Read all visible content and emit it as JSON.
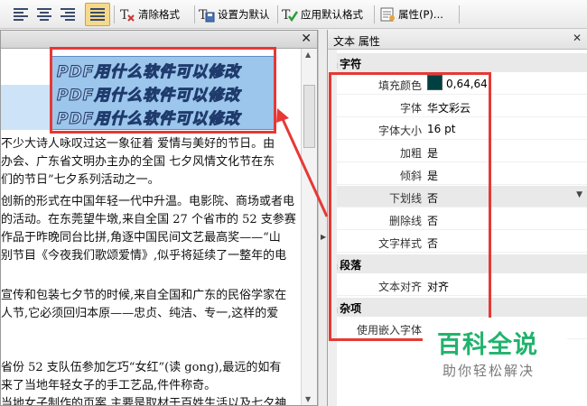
{
  "toolbar": {
    "clear_format": "清除格式",
    "set_default": "设置为默认",
    "apply_default": "应用默认格式",
    "properties": "属性(P)..."
  },
  "document": {
    "selected_lines": [
      "PDF用什么软件可以修改",
      "PDF用什么软件可以修改",
      "PDF用什么软件可以修改"
    ],
    "lines": [
      "不少大诗人咏叹过这一象征着 爱情与美好的节日。由",
      "办会、广东省文明办主办的全国 七夕风情文化节在东",
      "们的节日”七夕系列活动之一。",
      "创新的形式在中国年轻一代中升温。电影院、商场或者电",
      "的活动。在东莞望牛墩,来自全国 27 个省市的 52 支参赛",
      "作品于昨晚同台比拼,角逐中国民间文艺最高奖——“山",
      "别节目《今夜我们歌颂爱情》,似乎将延续了一整年的电",
      "",
      "宣传和包装七夕节的时候,来自全国和广东的民俗学家在",
      "人节,它必须回归本原——忠贞、纯洁、专一,这样的爱",
      "",
      "",
      "省份 52 支队伍参加乞巧“女红”(读 gong),最远的如有",
      "来了当地年轻女子的手工艺品,件件称奇。",
      "当地女子制作的页案,主要是取材于百姓生活以及七夕神"
    ]
  },
  "properties_panel": {
    "title": "文本 属性",
    "categories": {
      "character": "字符",
      "paragraph": "段落",
      "misc": "杂项"
    },
    "rows": {
      "fill_color": {
        "key": "填充颜色",
        "value": "0,64,64",
        "color": "#004040"
      },
      "font": {
        "key": "字体",
        "value": "华文彩云"
      },
      "font_size": {
        "key": "字体大小",
        "value": "16 pt"
      },
      "bold": {
        "key": "加粗",
        "value": "是"
      },
      "italic": {
        "key": "倾斜",
        "value": "是"
      },
      "underline": {
        "key": "下划线",
        "value": "否"
      },
      "strikethrough": {
        "key": "删除线",
        "value": "否"
      },
      "text_style": {
        "key": "文字样式",
        "value": "否"
      },
      "text_align": {
        "key": "文本对齐",
        "value": "对齐"
      },
      "embedded_font": {
        "key": "使用嵌入字体",
        "value": ""
      }
    }
  },
  "watermark": {
    "brand": "百科全说",
    "slogan": "助你轻松解决"
  }
}
